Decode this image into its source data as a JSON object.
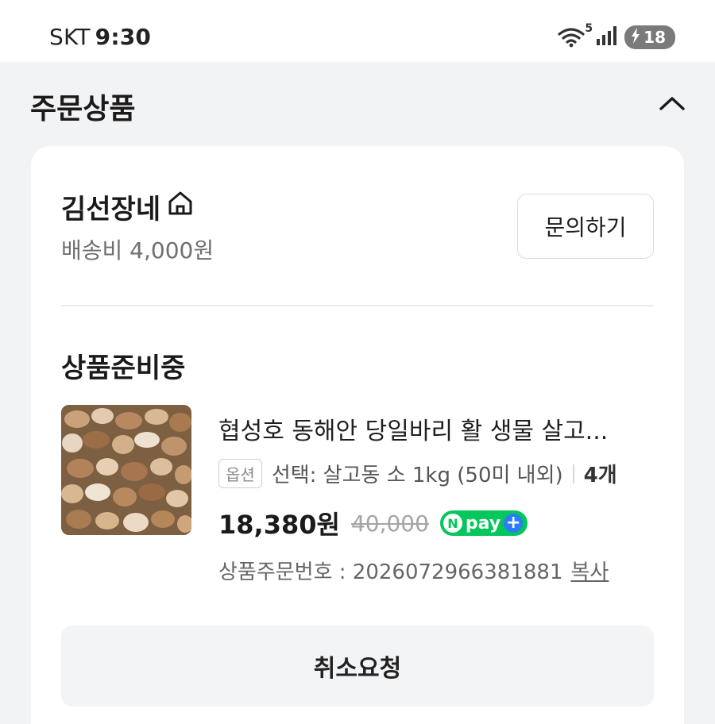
{
  "status_bar": {
    "carrier": "SKT",
    "time": "9:30",
    "wifi_badge": "5",
    "battery_level": "18",
    "icons": [
      "wifi-icon",
      "signal-icon",
      "battery-charging-icon"
    ]
  },
  "section": {
    "title": "주문상품",
    "collapse_icon": "chevron-up-icon"
  },
  "seller": {
    "name": "김선장네",
    "home_icon": "home-icon",
    "shipping_fee": "배송비 4,000원",
    "inquiry_label": "문의하기"
  },
  "order": {
    "status": "상품준비중",
    "product_title": "협성호 동해안 당일바리 활 생물 살고...",
    "option_tag": "옵션",
    "option_text": "선택: 살고동 소 1kg (50미 내외)",
    "quantity": "4개",
    "price": "18,380원",
    "original_price": "40,000",
    "npay_label": "pay",
    "npay_n": "N",
    "order_number_label": "상품주문번호 : 2026072966381881",
    "copy_label": "복사",
    "cancel_label": "취소요청"
  },
  "colors": {
    "background": "#f2f3f5",
    "card": "#ffffff",
    "npay_green": "#03c75a",
    "npay_plus_blue": "#2b7cf6",
    "cancel_button_bg": "#f3f4f6"
  }
}
